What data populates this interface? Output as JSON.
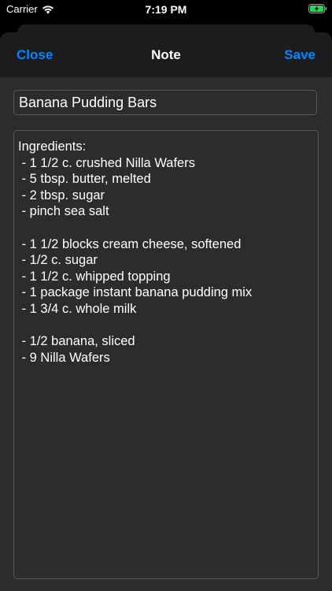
{
  "status_bar": {
    "carrier": "Carrier",
    "time": "7:19 PM",
    "icons": [
      "wifi-icon",
      "battery-charging-icon"
    ]
  },
  "nav": {
    "close_label": "Close",
    "title": "Note",
    "save_label": "Save",
    "accent_color": "#0a84ff"
  },
  "note": {
    "title_value": "Banana Pudding Bars",
    "body_value": "Ingredients:\n - 1 1/2 c. crushed Nilla Wafers\n - 5 tbsp. butter, melted\n - 2 tbsp. sugar\n - pinch sea salt\n\n - 1 1/2 blocks cream cheese, softened\n - 1/2 c. sugar\n - 1 1/2 c. whipped topping\n - 1 package instant banana pudding mix\n - 1 3/4 c. whole milk\n\n - 1/2 banana, sliced\n - 9 Nilla Wafers"
  }
}
